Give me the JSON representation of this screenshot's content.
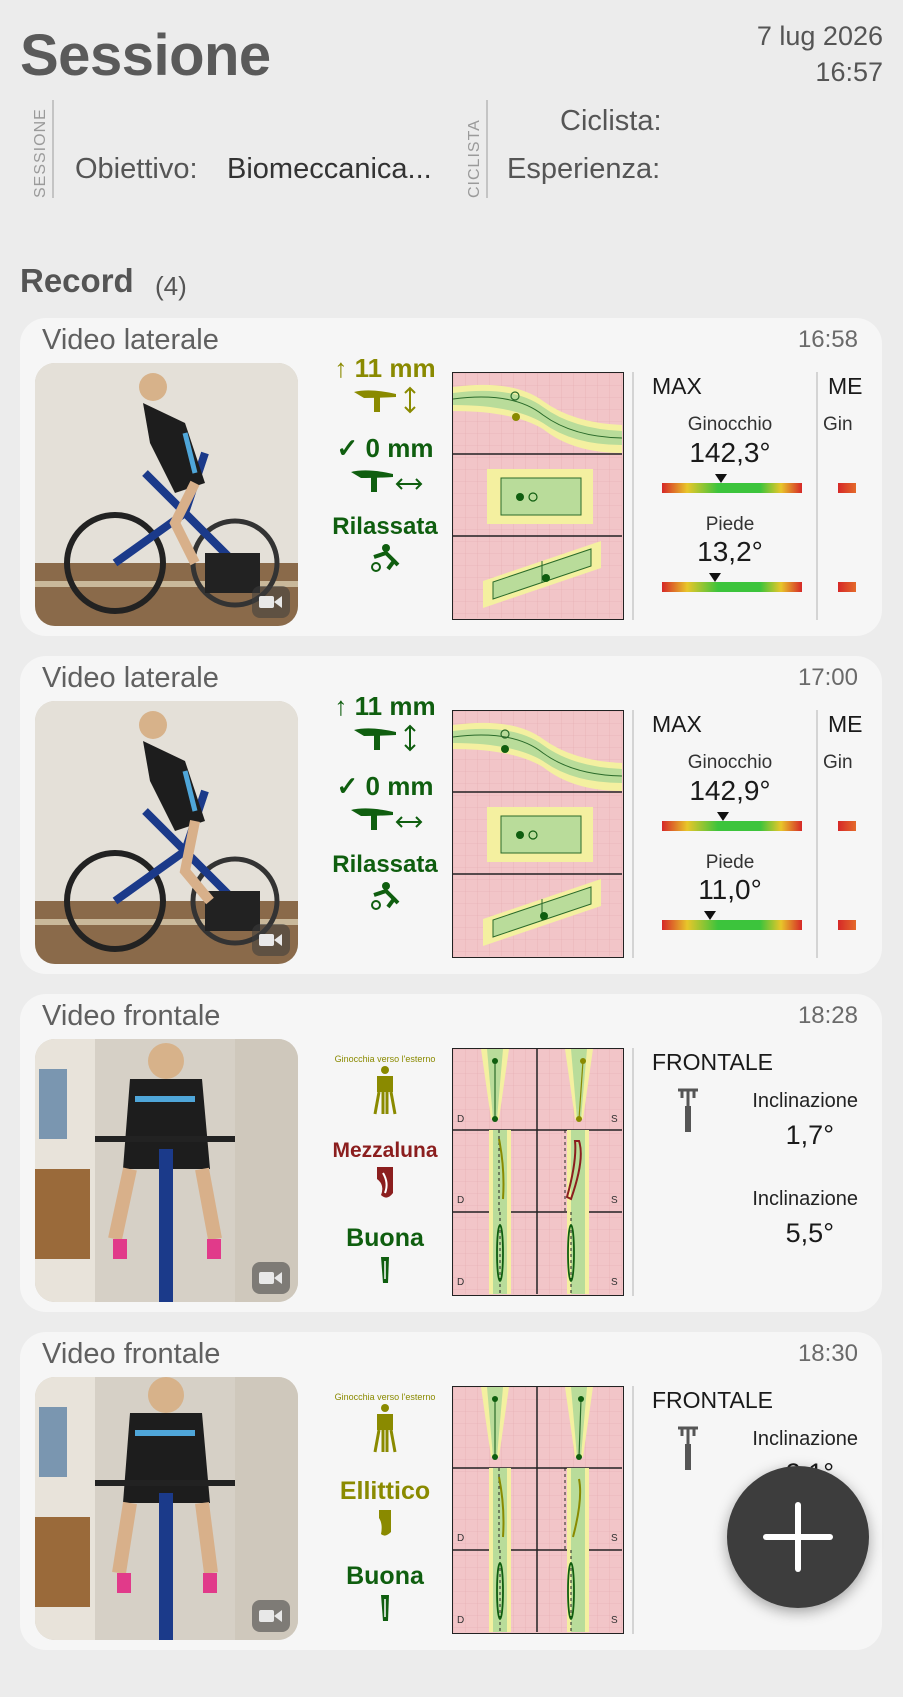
{
  "header": {
    "title": "Sessione",
    "date": "7 lug 2026",
    "time": "16:57"
  },
  "session": {
    "section_label": "SESSIONE",
    "goal_label": "Obiettivo:",
    "goal_value": "Biomeccanica..."
  },
  "cyclist": {
    "section_label": "CICLISTA",
    "cyclist_label": "Ciclista:",
    "experience_label": "Esperienza:"
  },
  "records": {
    "title": "Record",
    "count": "(4)"
  },
  "cards": [
    {
      "title": "Video laterale",
      "time": "16:58",
      "metric_height": "↑ 11 mm",
      "metric_setback": "✓ 0 mm",
      "metric_posture": "Rilassata",
      "max_label": "MAX",
      "other_label": "ME",
      "knee_label": "Ginocchio",
      "knee_value": "142,3°",
      "knee_marker": 0.42,
      "other_knee_label": "Gin",
      "foot_label": "Piede",
      "foot_value": "13,2°",
      "foot_marker": 0.38
    },
    {
      "title": "Video laterale",
      "time": "17:00",
      "metric_height": "↑ 11 mm",
      "metric_setback": "✓ 0 mm",
      "metric_posture": "Rilassata",
      "max_label": "MAX",
      "other_label": "ME",
      "knee_label": "Ginocchio",
      "knee_value": "142,9°",
      "knee_marker": 0.44,
      "other_knee_label": "Gin",
      "foot_label": "Piede",
      "foot_value": "11,0°",
      "foot_marker": 0.34
    },
    {
      "title": "Video frontale",
      "time": "18:28",
      "knee_note": "Ginocchia verso l'esterno",
      "path_shape": "Mezzaluna",
      "quality": "Buona",
      "frontal_label": "FRONTALE",
      "incl1_label": "Inclinazione",
      "incl1_value": "1,7°",
      "incl2_label": "Inclinazione",
      "incl2_value": "5,5°",
      "grid_left": "D",
      "grid_right": "S"
    },
    {
      "title": "Video frontale",
      "time": "18:30",
      "knee_note": "Ginocchia verso l'esterno",
      "path_shape": "Ellittico",
      "quality": "Buona",
      "frontal_label": "FRONTALE",
      "incl1_label": "Inclinazione",
      "incl1_value": "2,1°",
      "grid_left": "D",
      "grid_right": "S"
    }
  ],
  "colors": {
    "olive": "#8a8a00",
    "dark_green": "#0f5e0f",
    "dark_red": "#8b1e1e",
    "grid_pink": "#f2c5c8",
    "band_green": "#b9dc9a",
    "band_yellow": "#f4f0a0"
  },
  "icons": {
    "fab": "plus-icon",
    "thumb": "video-camera-icon"
  }
}
